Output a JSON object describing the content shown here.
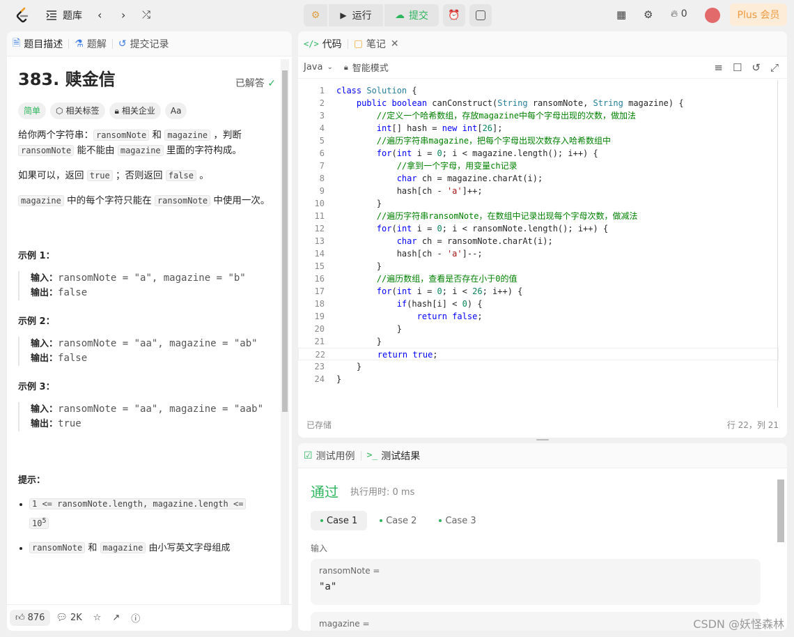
{
  "topbar": {
    "problist_label": "题库",
    "run_label": "运行",
    "submit_label": "提交",
    "fire_count": "0",
    "plus_label": "Plus 会员"
  },
  "left_tabs": [
    "题目描述",
    "题解",
    "提交记录"
  ],
  "problem": {
    "title": "383. 赎金信",
    "solved": "已解答",
    "difficulty": "简单",
    "tag_labels": "相关标签",
    "company_label": "相关企业",
    "font_icon": "Aa",
    "p1_a": "给你两个字符串：",
    "p1_code1": "ransomNote",
    "p1_b": " 和 ",
    "p1_code2": "magazine",
    "p1_c": " ，判断 ",
    "p1_code3": "ransomNote",
    "p1_d": " 能不能由 ",
    "p1_code4": "magazine",
    "p1_e": " 里面的字符构成。",
    "p2_a": "如果可以，返回 ",
    "p2_code1": "true",
    "p2_b": " ；否则返回 ",
    "p2_code2": "false",
    "p2_c": " 。",
    "p3_code1": "magazine",
    "p3_a": " 中的每个字符只能在 ",
    "p3_code2": "ransomNote",
    "p3_b": " 中使用一次。",
    "examples": [
      {
        "title": "示例 1：",
        "in_label": "输入：",
        "input": "ransomNote = \"a\", magazine = \"b\"",
        "out_label": "输出：",
        "output": "false"
      },
      {
        "title": "示例 2：",
        "in_label": "输入：",
        "input": "ransomNote = \"aa\", magazine = \"ab\"",
        "out_label": "输出：",
        "output": "false"
      },
      {
        "title": "示例 3：",
        "in_label": "输入：",
        "input": "ransomNote = \"aa\", magazine = \"aab\"",
        "out_label": "输出：",
        "output": "true"
      }
    ],
    "hints_title": "提示：",
    "hint1_code": "1 <= ransomNote.length, magazine.length <=",
    "hint1_code2": "10",
    "hint1_sup": "5",
    "hint2_code1": "ransomNote",
    "hint2_a": " 和 ",
    "hint2_code2": "magazine",
    "hint2_b": " 由小写英文字母组成"
  },
  "bottom_actions": {
    "likes": "876",
    "comments": "2K"
  },
  "editor": {
    "tab_code": "代码",
    "tab_notes": "笔记",
    "language": "Java",
    "mode": "智能模式",
    "saved": "已存储",
    "position": "行 22，列 21",
    "lines": [
      "class Solution {",
      "    public boolean canConstruct(String ransomNote, String magazine) {",
      "        //定义一个哈希数组，存放magazine中每个字母出现的次数，做加法",
      "        int[] hash = new int[26];",
      "        //遍历字符串magazine，把每个字母出现次数存入哈希数组中",
      "        for(int i = 0; i < magazine.length(); i++) {",
      "            //拿到一个字母，用变量ch记录",
      "            char ch = magazine.charAt(i);",
      "            hash[ch - 'a']++;",
      "        }",
      "        //遍历字符串ransomNote，在数组中记录出现每个字母次数，做减法",
      "        for(int i = 0; i < ransomNote.length(); i++) {",
      "            char ch = ransomNote.charAt(i);",
      "            hash[ch - 'a']--;",
      "        }",
      "        //遍历数组，查看是否存在小于0的值",
      "        for(int i = 0; i < 26; i++) {",
      "            if(hash[i] < 0) {",
      "                return false;",
      "            }",
      "        }",
      "        return true;",
      "    }",
      "}"
    ]
  },
  "test": {
    "tab_cases": "测试用例",
    "tab_results": "测试结果",
    "status": "通过",
    "runtime": "执行用时: 0 ms",
    "cases": [
      "Case 1",
      "Case 2",
      "Case 3"
    ],
    "input_label": "输入",
    "var1_name": "ransomNote =",
    "var1_value": "\"a\"",
    "var2_name": "magazine ="
  },
  "watermark": "CSDN @妖怪森林",
  "colors": {
    "accent_green": "#2db55d",
    "plus_bg": "#fdecd8",
    "plus_text": "#f09a40"
  }
}
